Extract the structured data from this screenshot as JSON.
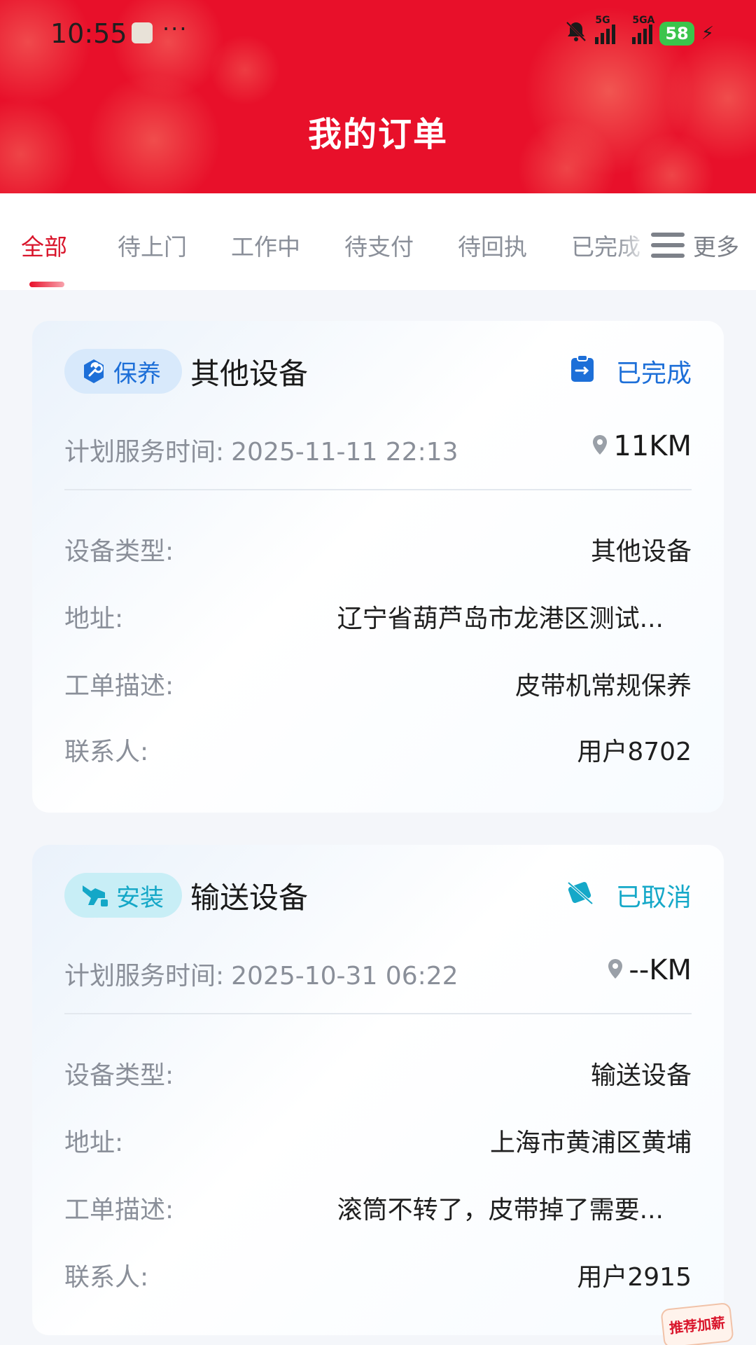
{
  "status_bar": {
    "time": "10:55",
    "more": "···",
    "signal1_label": "5G",
    "signal2_label": "5GA",
    "battery": "58"
  },
  "header": {
    "title": "我的订单"
  },
  "tabs": {
    "items": [
      {
        "label": "全部",
        "active": true
      },
      {
        "label": "待上门"
      },
      {
        "label": "工作中"
      },
      {
        "label": "待支付"
      },
      {
        "label": "待回执"
      },
      {
        "label": "已完成"
      }
    ],
    "more_label": "更多"
  },
  "orders": [
    {
      "tag": "保养",
      "tag_color": "#1d6fd8",
      "device_title": "其他设备",
      "status": "已完成",
      "time_label": "计划服务时间:",
      "time_value": "2025-11-11 22:13",
      "distance": "11KM",
      "fields": {
        "type_label": "设备类型:",
        "type_value": "其他设备",
        "address_label": "地址:",
        "address_value": "辽宁省葫芦岛市龙港区测试...",
        "desc_label": "工单描述:",
        "desc_value": "皮带机常规保养",
        "contact_label": "联系人:",
        "contact_value": "用户8702"
      }
    },
    {
      "tag": "安装",
      "tag_color": "#14a7c7",
      "device_title": "输送设备",
      "status": "已取消",
      "time_label": "计划服务时间:",
      "time_value": "2025-10-31 06:22",
      "distance": "--KM",
      "fields": {
        "type_label": "设备类型:",
        "type_value": "输送设备",
        "address_label": "地址:",
        "address_value": "上海市黄浦区黄埔",
        "desc_label": "工单描述:",
        "desc_value": "滚筒不转了，皮带掉了需要...",
        "contact_label": "联系人:",
        "contact_value": "用户2915"
      }
    }
  ],
  "promo": {
    "label": "推荐加薪"
  }
}
